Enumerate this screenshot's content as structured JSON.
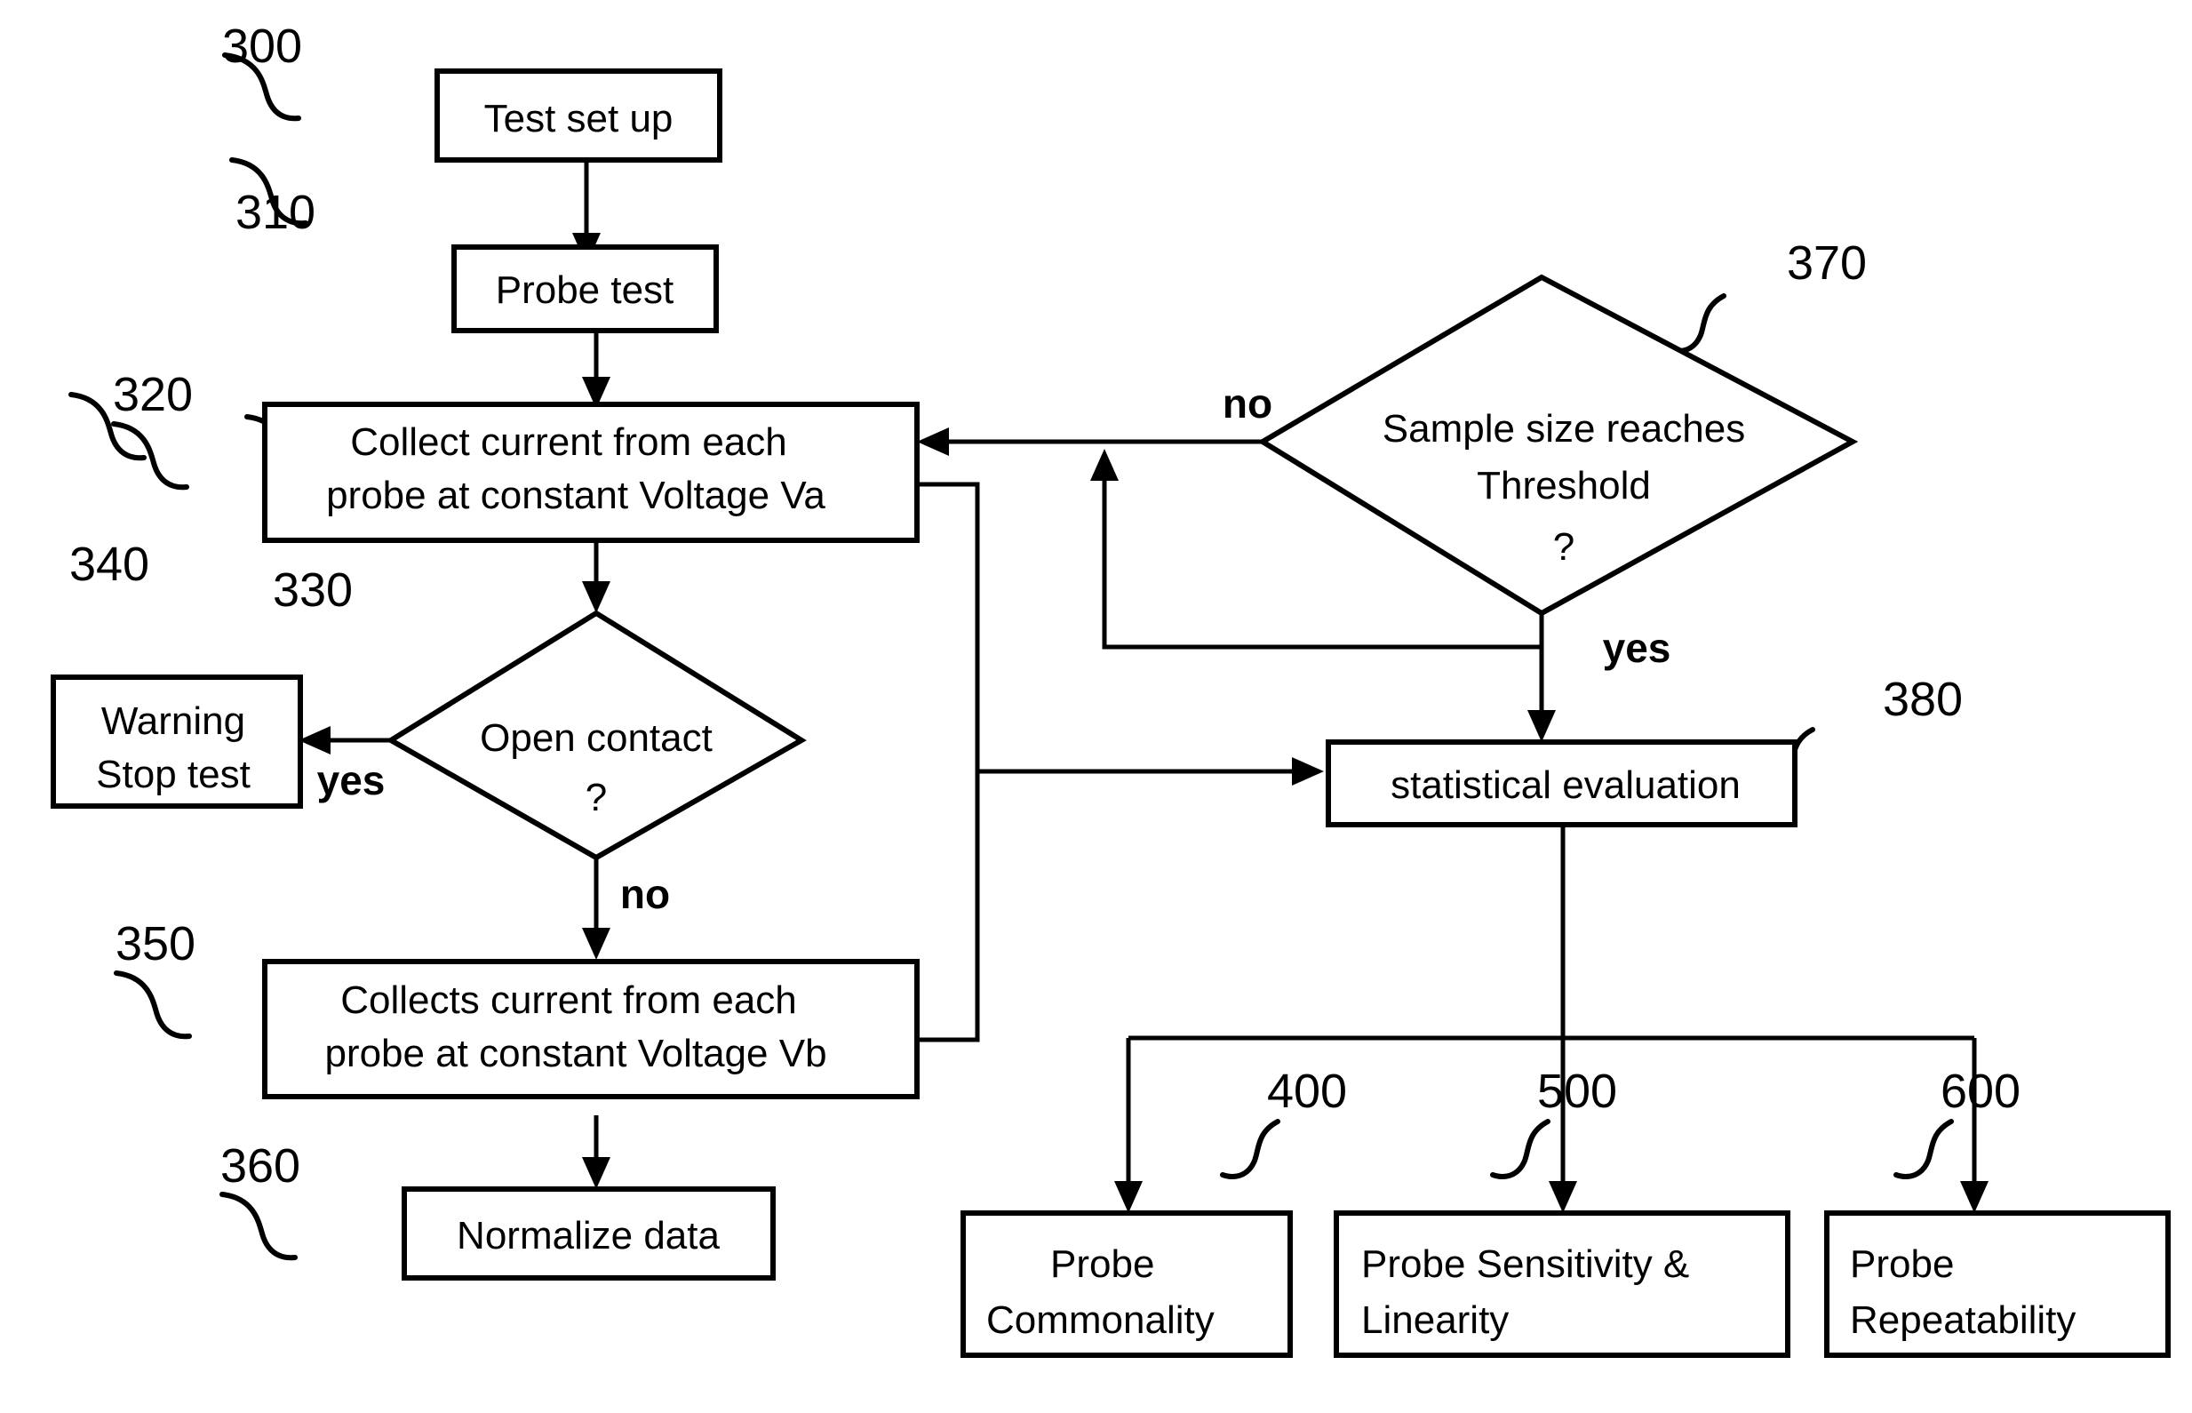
{
  "diagram": {
    "title": "Probe test flowchart",
    "stroke_color": "#000000",
    "background_color": "#ffffff"
  },
  "nodes": {
    "test_setup": {
      "ref": "300",
      "label": "Test set up",
      "shape": "process"
    },
    "probe_test": {
      "ref": "310",
      "label": "Probe test",
      "shape": "process"
    },
    "collect_va": {
      "ref": "320",
      "label_line1": "Collect current from each",
      "label_line2": "probe at constant Voltage Va",
      "shape": "process"
    },
    "open_contact": {
      "ref": "330",
      "label_line1": "Open contact",
      "label_line2": "?",
      "shape": "decision"
    },
    "warning": {
      "ref": "340",
      "label_line1": "Warning",
      "label_line2": "Stop test",
      "shape": "process"
    },
    "collect_vb": {
      "ref": "350",
      "label_line1": "Collects current from each",
      "label_line2": "probe at constant Voltage Vb",
      "shape": "process"
    },
    "normalize": {
      "ref": "360",
      "label": "Normalize data",
      "shape": "process"
    },
    "sample_size": {
      "ref": "370",
      "label_line1": "Sample size reaches",
      "label_line2": "Threshold",
      "label_line3": "?",
      "shape": "decision"
    },
    "statistical_evaluation": {
      "ref": "380",
      "label": "statistical evaluation",
      "shape": "process"
    },
    "probe_commonality": {
      "ref": "400",
      "label_line1": "Probe",
      "label_line2": "Commonality",
      "shape": "process"
    },
    "probe_sensitivity": {
      "ref": "500",
      "label_line1": "Probe Sensitivity &",
      "label_line2": "Linearity",
      "shape": "process"
    },
    "probe_repeatability": {
      "ref": "600",
      "label_line1": "Probe",
      "label_line2": "Repeatability",
      "shape": "process"
    }
  },
  "edge_labels": {
    "open_contact_yes": "yes",
    "open_contact_no": "no",
    "sample_size_no": "no",
    "sample_size_yes": "yes"
  }
}
